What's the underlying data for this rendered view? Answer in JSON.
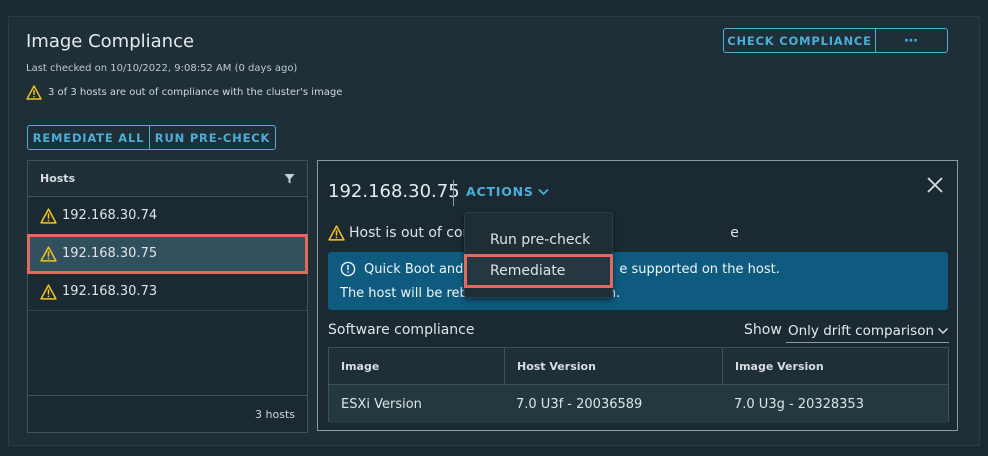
{
  "header": {
    "title": "Image Compliance",
    "last_checked": "Last checked on 10/10/2022, 9:08:52 AM (0 days ago)",
    "compliance_message": "3 of 3 hosts are out of compliance with the cluster's image",
    "check_compliance_label": "CHECK COMPLIANCE",
    "more_label": "⋯"
  },
  "toolbar": {
    "remediate_all_label": "REMEDIATE ALL",
    "run_precheck_label": "RUN PRE-CHECK"
  },
  "hosts": {
    "column_header": "Hosts",
    "rows": [
      {
        "name": "192.168.30.74"
      },
      {
        "name": "192.168.30.75"
      },
      {
        "name": "192.168.30.73"
      }
    ],
    "footer": "3 hosts",
    "selected": "192.168.30.75"
  },
  "detail": {
    "title": "192.168.30.75",
    "actions_label": "ACTIONS",
    "out_of_compliance_prefix": "Host is out of com",
    "out_of_compliance_suffix": "e",
    "info_line1_start": "Quick Boot and",
    "info_line1_end": "e supported on the host.",
    "info_line2_start": "The host will be rebo",
    "info_line2_end": "n.",
    "software_title": "Software compliance",
    "show_label": "Show",
    "show_value": "Only drift comparison",
    "table": {
      "headers": [
        "Image",
        "Host Version",
        "Image Version"
      ],
      "rows": [
        [
          "ESXi Version",
          "7.0 U3f - 20036589",
          "7.0 U3g - 20328353"
        ]
      ]
    }
  },
  "actions_menu": {
    "items": [
      {
        "label": "Run pre-check"
      },
      {
        "label": "Remediate"
      }
    ],
    "highlighted": "Remediate"
  },
  "colors": {
    "accent": "#49afd9",
    "warning": "#f5c518",
    "highlight": "#e06a5b",
    "info_bg": "#0f5b80"
  }
}
